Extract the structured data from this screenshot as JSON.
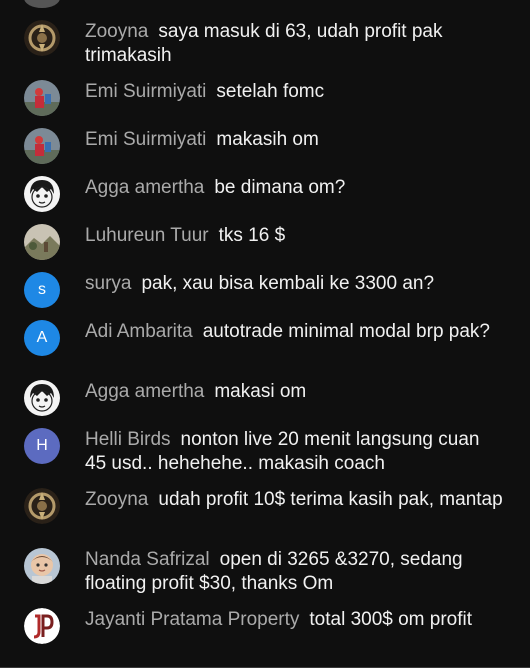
{
  "messages": [
    {
      "author": "Zooyna",
      "text": "saya masuk di 63, udah profit pak trimakasih",
      "avatar": {
        "kind": "image",
        "icon": "ornament-avatar"
      }
    },
    {
      "author": "Emi Suirmiyati",
      "text": "setelah fomc",
      "avatar": {
        "kind": "image",
        "icon": "photo-avatar"
      }
    },
    {
      "author": "Emi Suirmiyati",
      "text": "makasih om",
      "avatar": {
        "kind": "image",
        "icon": "photo-avatar"
      }
    },
    {
      "author": "Agga amertha",
      "text": "be dimana om?",
      "avatar": {
        "kind": "image",
        "icon": "cartoon-face-avatar"
      }
    },
    {
      "author": "Luhureun Tuur",
      "text": "tks 16 $",
      "avatar": {
        "kind": "image",
        "icon": "landscape-avatar"
      }
    },
    {
      "author": "surya",
      "text": "pak, xau bisa kembali ke 3300 an?",
      "avatar": {
        "kind": "letter",
        "letter": "s",
        "color": "#1e88e5"
      }
    },
    {
      "author": "Adi Ambarita",
      "text": "autotrade minimal modal brp pak?",
      "avatar": {
        "kind": "letter",
        "letter": "A",
        "color": "#1e88e5"
      }
    },
    {
      "author": "Agga amertha",
      "text": "makasi om",
      "avatar": {
        "kind": "image",
        "icon": "cartoon-face-avatar"
      }
    },
    {
      "author": "Helli Birds",
      "text": "nonton live 20 menit langsung cuan 45 usd.. hehehehe.. makasih coach",
      "avatar": {
        "kind": "letter",
        "letter": "H",
        "color": "#5c6bc0"
      }
    },
    {
      "author": "Zooyna",
      "text": "udah profit 10$ terima kasih pak, mantap",
      "avatar": {
        "kind": "image",
        "icon": "ornament-avatar"
      }
    },
    {
      "author": "Nanda Safrizal",
      "text": "open di 3265 &3270, sedang floating profit $30, thanks Om",
      "avatar": {
        "kind": "image",
        "icon": "baby-photo-avatar"
      }
    },
    {
      "author": "Jayanti Pratama Property",
      "text": "total 300$ om profit",
      "avatar": {
        "kind": "image",
        "icon": "jp-logo-avatar"
      }
    }
  ]
}
